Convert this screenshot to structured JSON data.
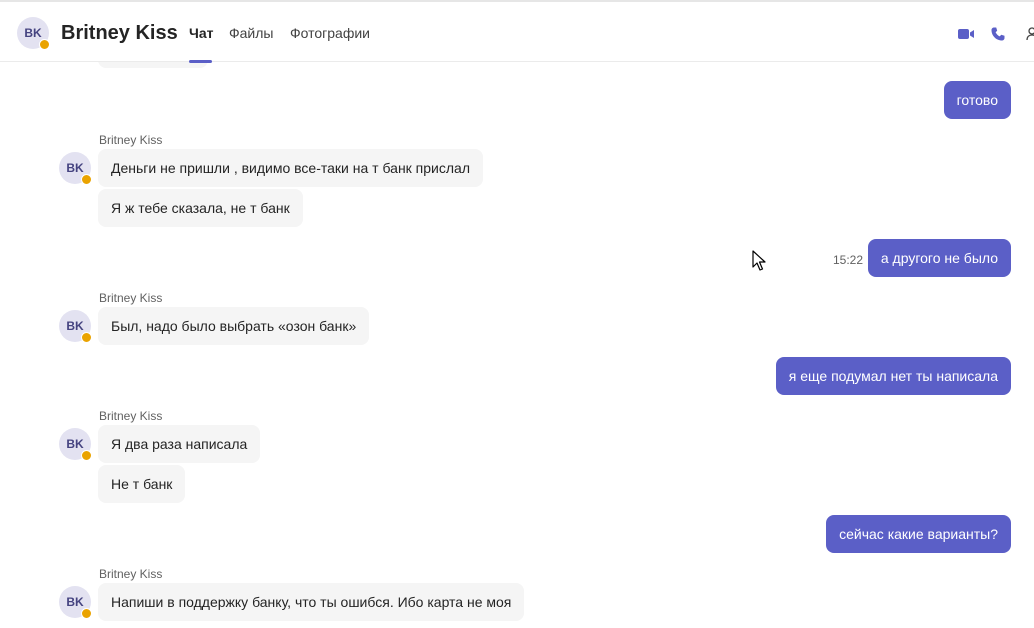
{
  "header": {
    "avatar_initials": "BK",
    "contact_name": "Britney Kiss",
    "tabs": [
      {
        "label": "Чат",
        "active": true
      },
      {
        "label": "Файлы",
        "active": false
      },
      {
        "label": "Фотографии",
        "active": false
      }
    ],
    "icons": [
      "video-call-icon",
      "audio-call-icon",
      "people-icon"
    ]
  },
  "colors": {
    "accent": "#5b5fc7",
    "incoming_bubble": "#f5f5f5",
    "avatar_bg": "#e3e2f1",
    "status_away": "#eaa300"
  },
  "messages": [
    {
      "id": "m0",
      "direction": "in",
      "text": ""
    },
    {
      "id": "m1",
      "direction": "out",
      "text": "готово"
    },
    {
      "id": "g1",
      "sender": "Britney Kiss",
      "avatar": "BK",
      "direction": "in",
      "texts": [
        "Деньги не пришли , видимо все-таки на т банк прислал",
        "Я ж тебе сказала, не т банк"
      ]
    },
    {
      "id": "m2",
      "direction": "out",
      "time": "15:22",
      "text": "а другого не было"
    },
    {
      "id": "g2",
      "sender": "Britney Kiss",
      "avatar": "BK",
      "direction": "in",
      "texts": [
        "Был, надо было выбрать «озон банк»"
      ]
    },
    {
      "id": "m3",
      "direction": "out",
      "text": "я еще подумал нет ты написала"
    },
    {
      "id": "g3",
      "sender": "Britney Kiss",
      "avatar": "BK",
      "direction": "in",
      "texts": [
        "Я два раза написала",
        "Не т банк"
      ]
    },
    {
      "id": "m4",
      "direction": "out",
      "text": "сейчас какие варианты?"
    },
    {
      "id": "g4",
      "sender": "Britney Kiss",
      "avatar": "BK",
      "direction": "in",
      "texts": [
        "Напиши в поддержку банку, что ты ошибся. Ибо карта не моя"
      ]
    }
  ]
}
